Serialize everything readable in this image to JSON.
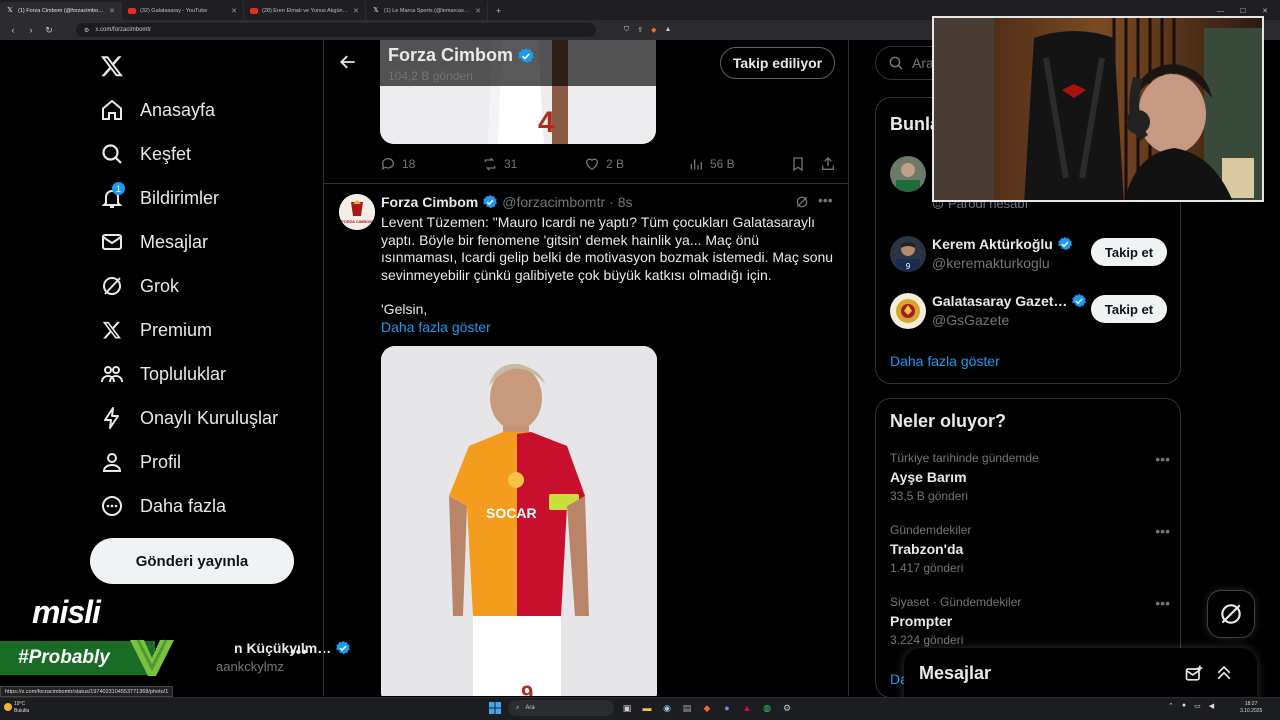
{
  "browser": {
    "tabs": [
      {
        "title": "(1) Forza Cimbom (@forzacimbo…",
        "icon": "x-icon",
        "active": true
      },
      {
        "title": "(32) Galatasaray - YouTube",
        "icon": "youtube-icon",
        "active": false
      },
      {
        "title": "(28) Eren Elmalı ve Yunus Akgün, EA…",
        "icon": "youtube-icon",
        "active": false
      },
      {
        "title": "(1) Le Marca Sports (@lemarcaspor…",
        "icon": "x-icon",
        "active": false
      }
    ],
    "new_tab": "+",
    "url": "x.com/forzacimbomtr",
    "status_url": "https://x.com/forzacimbomtr/status/1974023104553771368/photo/1"
  },
  "nav": {
    "items": [
      {
        "label": "Anasayfa",
        "icon": "home-icon"
      },
      {
        "label": "Keşfet",
        "icon": "search-icon"
      },
      {
        "label": "Bildirimler",
        "icon": "bell-icon",
        "badge": "1"
      },
      {
        "label": "Mesajlar",
        "icon": "mail-icon"
      },
      {
        "label": "Grok",
        "icon": "grok-icon"
      },
      {
        "label": "Premium",
        "icon": "x-icon"
      },
      {
        "label": "Topluluklar",
        "icon": "communities-icon"
      },
      {
        "label": "Onaylı Kuruluşlar",
        "icon": "lightning-icon"
      },
      {
        "label": "Profil",
        "icon": "person-icon"
      },
      {
        "label": "Daha fazla",
        "icon": "more-circle-icon"
      }
    ],
    "post_button": "Gönderi yayınla"
  },
  "account": {
    "name": "n Küçükyılm…",
    "handle": "aankckylmz",
    "more": "•••"
  },
  "overlay": {
    "brand": "misli",
    "hashtag": "#Probably"
  },
  "header": {
    "title": "Forza Cimbom",
    "subtitle": "104,2 B gönderi",
    "follow_button": "Takip ediliyor"
  },
  "prev_post_actions": {
    "replies": "18",
    "reposts": "31",
    "likes": "2 B",
    "views": "56 B"
  },
  "post": {
    "name": "Forza Cimbom",
    "handle": "@forzacimbomtr",
    "time": "· 8s",
    "text": "Levent Tüzemen: \"Mauro Icardi ne yaptı? Tüm çocukları Galatasaraylı yaptı. Böyle bir fenomene 'gitsin' demek hainlik ya... Maç önü ısınmaması, Icardi gelip belki de motivasyon bozmak istemedi. Maç sonu sevinmeyebilir çünkü galibiyete çok büyük katkısı olmadığı için.",
    "text2": "'Gelsin,",
    "show_more": "Daha fazla göster",
    "jersey_text": "SOCAR",
    "jersey_number": "9",
    "avatar_text": "FORZA CIMBOM"
  },
  "search": {
    "placeholder": "Ara"
  },
  "who_to_follow": {
    "title": "Bunla",
    "partial_label": "Parodi hesabı",
    "accounts": [
      {
        "name": "Kerem Aktürkoğlu",
        "handle": "@keremakturkoglu",
        "button": "Takip et"
      },
      {
        "name": "Galatasaray Gazet…",
        "handle": "@GsGazete",
        "button": "Takip et"
      }
    ],
    "show_more": "Daha fazla göster"
  },
  "trends": {
    "title": "Neler oluyor?",
    "items": [
      {
        "category": "Türkiye tarihinde gündemde",
        "name": "Ayşe Barım",
        "count": "33,5 B gönderi"
      },
      {
        "category": "Gündemdekiler",
        "name": "Trabzon'da",
        "count": "1.417 gönderi"
      },
      {
        "category": "Siyaset · Gündemdekiler",
        "name": "Prompter",
        "count": "3.224 gönderi"
      }
    ],
    "partial_link": "Da"
  },
  "messages_drawer": {
    "title": "Mesajlar"
  },
  "taskbar": {
    "weather_temp": "19°C",
    "weather_desc": "Bulutlu",
    "search": "Ara",
    "time": "18:27",
    "date": "3.10.2025"
  },
  "colors": {
    "accent": "#1d9bf0",
    "background": "#000000",
    "border": "#2f3336",
    "muted": "#71767b",
    "overlay_green": "#1a6b26"
  }
}
